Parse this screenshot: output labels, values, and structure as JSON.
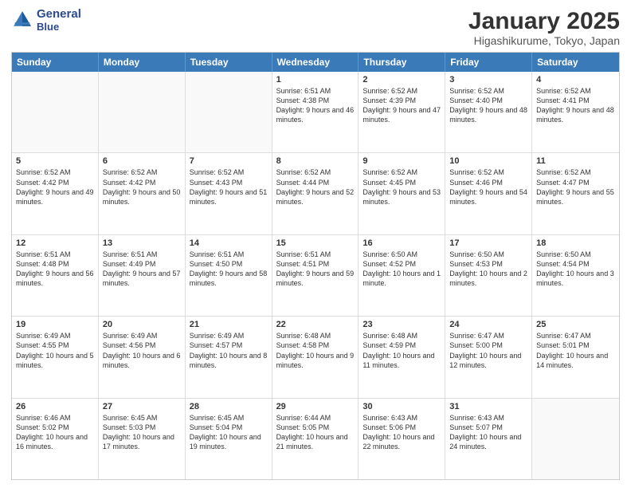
{
  "logo": {
    "line1": "General",
    "line2": "Blue"
  },
  "header": {
    "month": "January 2025",
    "location": "Higashikurume, Tokyo, Japan"
  },
  "days": [
    "Sunday",
    "Monday",
    "Tuesday",
    "Wednesday",
    "Thursday",
    "Friday",
    "Saturday"
  ],
  "weeks": [
    [
      {
        "day": "",
        "text": ""
      },
      {
        "day": "",
        "text": ""
      },
      {
        "day": "",
        "text": ""
      },
      {
        "day": "1",
        "text": "Sunrise: 6:51 AM\nSunset: 4:38 PM\nDaylight: 9 hours and 46 minutes."
      },
      {
        "day": "2",
        "text": "Sunrise: 6:52 AM\nSunset: 4:39 PM\nDaylight: 9 hours and 47 minutes."
      },
      {
        "day": "3",
        "text": "Sunrise: 6:52 AM\nSunset: 4:40 PM\nDaylight: 9 hours and 48 minutes."
      },
      {
        "day": "4",
        "text": "Sunrise: 6:52 AM\nSunset: 4:41 PM\nDaylight: 9 hours and 48 minutes."
      }
    ],
    [
      {
        "day": "5",
        "text": "Sunrise: 6:52 AM\nSunset: 4:42 PM\nDaylight: 9 hours and 49 minutes."
      },
      {
        "day": "6",
        "text": "Sunrise: 6:52 AM\nSunset: 4:42 PM\nDaylight: 9 hours and 50 minutes."
      },
      {
        "day": "7",
        "text": "Sunrise: 6:52 AM\nSunset: 4:43 PM\nDaylight: 9 hours and 51 minutes."
      },
      {
        "day": "8",
        "text": "Sunrise: 6:52 AM\nSunset: 4:44 PM\nDaylight: 9 hours and 52 minutes."
      },
      {
        "day": "9",
        "text": "Sunrise: 6:52 AM\nSunset: 4:45 PM\nDaylight: 9 hours and 53 minutes."
      },
      {
        "day": "10",
        "text": "Sunrise: 6:52 AM\nSunset: 4:46 PM\nDaylight: 9 hours and 54 minutes."
      },
      {
        "day": "11",
        "text": "Sunrise: 6:52 AM\nSunset: 4:47 PM\nDaylight: 9 hours and 55 minutes."
      }
    ],
    [
      {
        "day": "12",
        "text": "Sunrise: 6:51 AM\nSunset: 4:48 PM\nDaylight: 9 hours and 56 minutes."
      },
      {
        "day": "13",
        "text": "Sunrise: 6:51 AM\nSunset: 4:49 PM\nDaylight: 9 hours and 57 minutes."
      },
      {
        "day": "14",
        "text": "Sunrise: 6:51 AM\nSunset: 4:50 PM\nDaylight: 9 hours and 58 minutes."
      },
      {
        "day": "15",
        "text": "Sunrise: 6:51 AM\nSunset: 4:51 PM\nDaylight: 9 hours and 59 minutes."
      },
      {
        "day": "16",
        "text": "Sunrise: 6:50 AM\nSunset: 4:52 PM\nDaylight: 10 hours and 1 minute."
      },
      {
        "day": "17",
        "text": "Sunrise: 6:50 AM\nSunset: 4:53 PM\nDaylight: 10 hours and 2 minutes."
      },
      {
        "day": "18",
        "text": "Sunrise: 6:50 AM\nSunset: 4:54 PM\nDaylight: 10 hours and 3 minutes."
      }
    ],
    [
      {
        "day": "19",
        "text": "Sunrise: 6:49 AM\nSunset: 4:55 PM\nDaylight: 10 hours and 5 minutes."
      },
      {
        "day": "20",
        "text": "Sunrise: 6:49 AM\nSunset: 4:56 PM\nDaylight: 10 hours and 6 minutes."
      },
      {
        "day": "21",
        "text": "Sunrise: 6:49 AM\nSunset: 4:57 PM\nDaylight: 10 hours and 8 minutes."
      },
      {
        "day": "22",
        "text": "Sunrise: 6:48 AM\nSunset: 4:58 PM\nDaylight: 10 hours and 9 minutes."
      },
      {
        "day": "23",
        "text": "Sunrise: 6:48 AM\nSunset: 4:59 PM\nDaylight: 10 hours and 11 minutes."
      },
      {
        "day": "24",
        "text": "Sunrise: 6:47 AM\nSunset: 5:00 PM\nDaylight: 10 hours and 12 minutes."
      },
      {
        "day": "25",
        "text": "Sunrise: 6:47 AM\nSunset: 5:01 PM\nDaylight: 10 hours and 14 minutes."
      }
    ],
    [
      {
        "day": "26",
        "text": "Sunrise: 6:46 AM\nSunset: 5:02 PM\nDaylight: 10 hours and 16 minutes."
      },
      {
        "day": "27",
        "text": "Sunrise: 6:45 AM\nSunset: 5:03 PM\nDaylight: 10 hours and 17 minutes."
      },
      {
        "day": "28",
        "text": "Sunrise: 6:45 AM\nSunset: 5:04 PM\nDaylight: 10 hours and 19 minutes."
      },
      {
        "day": "29",
        "text": "Sunrise: 6:44 AM\nSunset: 5:05 PM\nDaylight: 10 hours and 21 minutes."
      },
      {
        "day": "30",
        "text": "Sunrise: 6:43 AM\nSunset: 5:06 PM\nDaylight: 10 hours and 22 minutes."
      },
      {
        "day": "31",
        "text": "Sunrise: 6:43 AM\nSunset: 5:07 PM\nDaylight: 10 hours and 24 minutes."
      },
      {
        "day": "",
        "text": ""
      }
    ]
  ]
}
